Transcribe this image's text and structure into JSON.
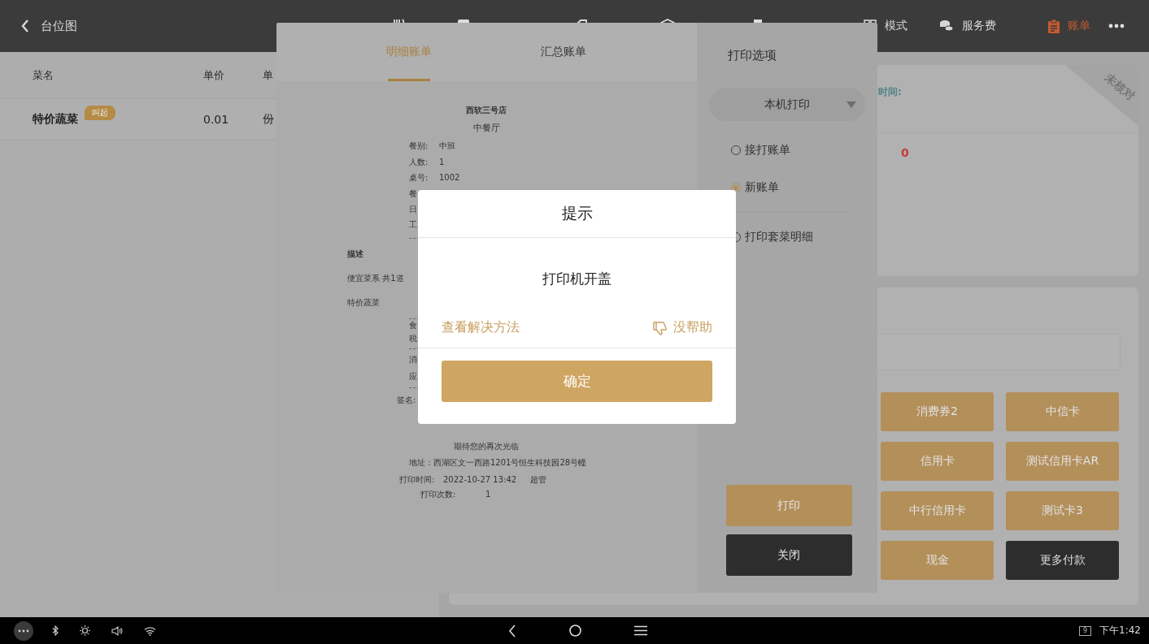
{
  "top_bar": {
    "back_label": "台位图",
    "nav": [
      {
        "label": "模式",
        "selected": false
      },
      {
        "label": "服务费",
        "selected": false
      },
      {
        "label": "账单",
        "selected": true
      }
    ]
  },
  "order_table": {
    "columns": [
      "菜名",
      "单价",
      "单"
    ],
    "rows": [
      {
        "cells": [
          "特价蔬菜",
          "0.01",
          "份"
        ],
        "badge": "叫起"
      }
    ]
  },
  "bill_card": {
    "time_label": "时间:",
    "amount": "0",
    "status_ribbon": "未核对"
  },
  "payment": {
    "methods": [
      {
        "label": "消费券2",
        "kind": "normal"
      },
      {
        "label": "中信卡",
        "kind": "normal"
      },
      {
        "label": "信用卡",
        "kind": "normal"
      },
      {
        "label": "测试信用卡AR",
        "kind": "normal"
      },
      {
        "label": "中行信用卡",
        "kind": "normal"
      },
      {
        "label": "测试卡3",
        "kind": "normal"
      },
      {
        "label": "现金",
        "kind": "normal"
      },
      {
        "label": "更多付款",
        "kind": "more"
      }
    ]
  },
  "bill_sheet": {
    "tabs": [
      {
        "label": "明细账单",
        "selected": true
      },
      {
        "label": "汇总账单",
        "selected": false
      }
    ],
    "receipt": {
      "store": "西软三号店",
      "hall": "中餐厅",
      "info": [
        {
          "label": "餐别:",
          "value": "中班"
        },
        {
          "label": "人数:",
          "value": "1"
        },
        {
          "label": "桌号:",
          "value": "1002"
        },
        {
          "label": "餐"
        },
        {
          "label": "日"
        },
        {
          "label": "工"
        }
      ],
      "items": [
        {
          "text": "描述",
          "kind": "heading"
        },
        {
          "text": "便宜菜系 共1道",
          "kind": "line"
        },
        {
          "text": "特价蔬菜",
          "kind": "line"
        }
      ],
      "totals_a": [
        "食",
        "税"
      ],
      "totals_b": [
        "消",
        "应"
      ],
      "signature": "签名:",
      "farewell": "期待您的再次光临",
      "address": "地址：西湖区文一西路1201号恒生科技园28号幢",
      "print_time": {
        "label": "打印时间:",
        "value": "2022-10-27 13:42",
        "operator": "超管"
      },
      "print_count": {
        "label": "打印次数:",
        "value": "1"
      }
    },
    "print_options": {
      "title": "打印选项",
      "printer": "本机打印",
      "modes": [
        {
          "label": "接打账单",
          "selected": false
        },
        {
          "label": "新账单",
          "selected": true
        }
      ],
      "set_detail": {
        "label": "打印套菜明细",
        "checked": false
      },
      "buttons": [
        {
          "label": "打印",
          "kind": "primary"
        },
        {
          "label": "关闭",
          "kind": "dark"
        }
      ]
    }
  },
  "dialog": {
    "title": "提示",
    "message": "打印机开盖",
    "help_link": "查看解决方法",
    "not_helpful": "没帮助",
    "confirm": "确定"
  },
  "system_bar": {
    "battery": "9",
    "time": "下午1:42"
  }
}
